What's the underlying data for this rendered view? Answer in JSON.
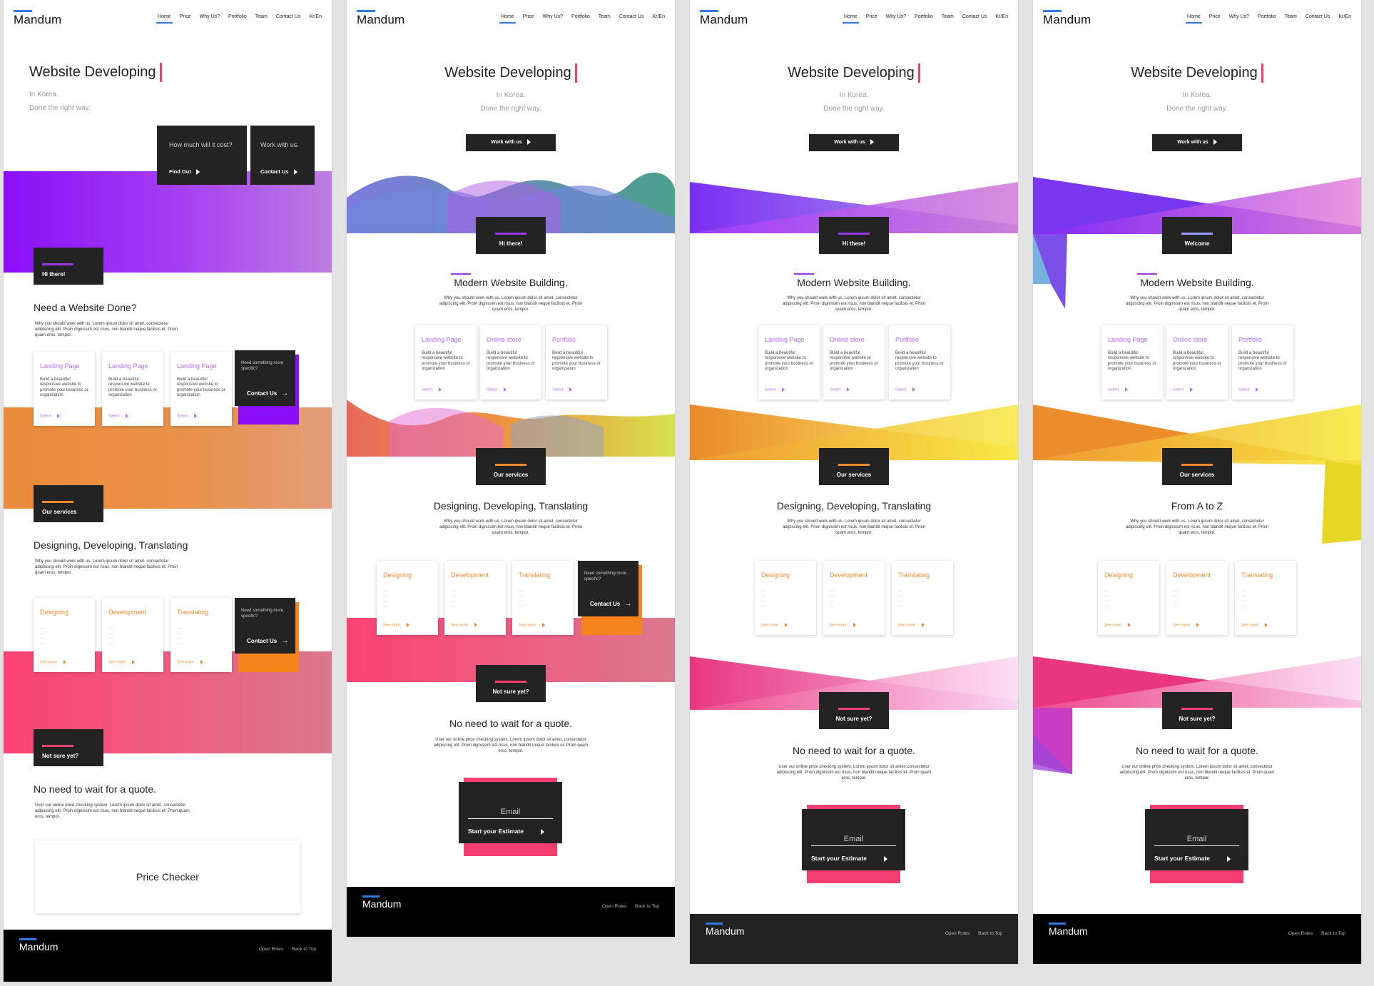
{
  "brand": "Mandum",
  "nav": [
    "Home",
    "Price",
    "Why Us?",
    "Portfolio",
    "Team",
    "Contact Us",
    "Kr/En"
  ],
  "hero": {
    "title": "Website Developing",
    "line1": "In Korea.",
    "line2": "Done the right way.",
    "work_btn": "Work with us"
  },
  "hero_boxes": {
    "cost_q": "How much will it cost?",
    "cost_link": "Find Out",
    "work_q": "Work with us.",
    "work_link": "Contact Us"
  },
  "colors": {
    "purple": "#9a37ea",
    "orange": "#f0892c",
    "pink": "#f43d71",
    "dark": "#232323",
    "blue": "#2f7be0"
  },
  "v1": {
    "hi": "Hi there!",
    "title": "Need a Website Done?",
    "body": "Why you should work with us. Lorem ipsum dolor sit amet, consectetur adipiscing elit. Proin dignissim est risus, non blandit neque facilisis et. Proin quam eros, tempor.",
    "services": "Our services",
    "services_title": "Designing, Developing, Translating",
    "notsure": "Not sure yet?",
    "quote_title": "No need to wait for a quote.",
    "quote_body": "User our online price checking system. Lorem ipsum dolor sit amet, consectetur adipiscing elit. Proin dignissim est risus, non blandit neque facilisis et. Proin quam eros, tempor.",
    "price_checker": "Price Checker"
  },
  "cards": {
    "landing": "Landing Page",
    "online": "Online store",
    "portfolio": "Portfolio",
    "desc": "Build a beautiful responsive website to promote your business or organization",
    "select": "Select",
    "designing": "Designing",
    "development": "Development",
    "translating": "Translating",
    "see_more": "See more",
    "dashes": "—\n—\n—\n—",
    "need": "Need something more specific?",
    "contact": "Contact Us"
  },
  "v2": {
    "hi": "Hi there!",
    "welcome": "Welcome",
    "title": "Modern Website Building.",
    "body": "Why you should work with us. Lorem ipsum dolor sit amet, consectetur adipiscing elit. Proin dignissim est risus, non blandit neque facilisis et. Proin quam eros, tempor.",
    "services": "Our services",
    "services_title": "Designing, Developing, Translating",
    "services_title_alt": "From A to Z",
    "notsure": "Not sure yet?",
    "quote_title": "No need to wait for a quote.",
    "quote_body": "User our online price checking system. Lorem ipsum dolor sit amet, consectetur adipiscing elit. Proin dignissim est risus, non blandit neque facilisis et. Proin quam eros, tempor.",
    "email": "Email",
    "estimate": "Start your Estimate"
  },
  "footer": {
    "open_roles": "Open Roles",
    "back_top": "Back to Top"
  }
}
